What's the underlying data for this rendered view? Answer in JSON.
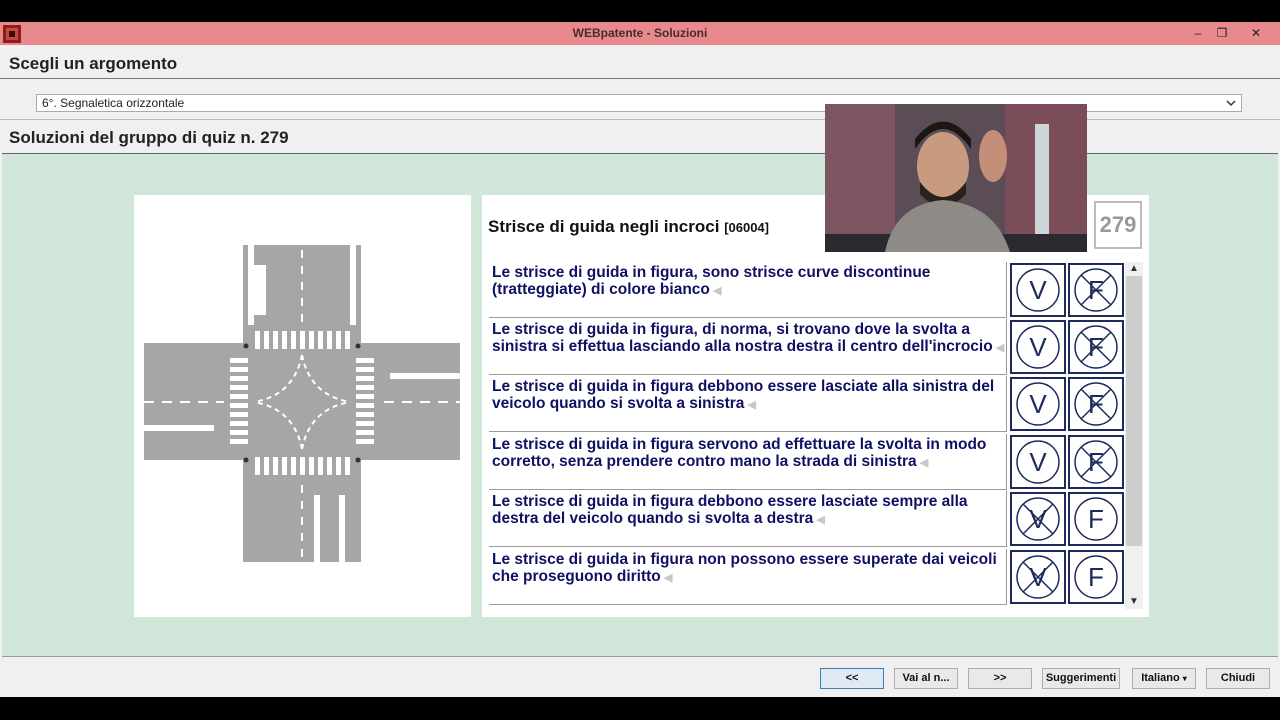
{
  "window": {
    "title": "WEBpatente - Soluzioni",
    "minimize": "–",
    "maximize": "❐",
    "close": "✕"
  },
  "topic": {
    "label": "Scegli un argomento",
    "selected": "6°. Segnaletica orizzontale"
  },
  "group": {
    "label": "Soluzioni del gruppo di quiz n. 279"
  },
  "quiz": {
    "title": "Strisce di guida negli incroci",
    "code": "[06004]",
    "number": "279",
    "questions": [
      {
        "text": "Le strisce di guida in figura, sono strisce curve discontinue (tratteggiate) di colore bianco",
        "answer": "V"
      },
      {
        "text": "Le strisce di guida in figura, di norma, si trovano dove la svolta a sinistra si effettua lasciando alla nostra destra il centro dell'incrocio",
        "answer": "V"
      },
      {
        "text": "Le strisce di guida in figura debbono essere lasciate alla sinistra del veicolo quando si svolta a sinistra",
        "answer": "V"
      },
      {
        "text": "Le strisce di guida in figura servono ad effettuare la svolta in modo corretto, senza prendere contro mano la strada di sinistra",
        "answer": "V"
      },
      {
        "text": "Le strisce di guida in figura debbono essere lasciate sempre alla destra del veicolo quando si svolta a destra",
        "answer": "F"
      },
      {
        "text": "Le strisce di guida in figura non possono essere superate dai veicoli che proseguono diritto",
        "answer": "F"
      }
    ]
  },
  "buttons": {
    "prev": "<<",
    "goto": "Vai al n...",
    "next": ">>",
    "hints": "Suggerimenti",
    "language": "Italiano",
    "close": "Chiudi"
  },
  "colors": {
    "titlebar": "#e8898e",
    "quiz_area": "#cfe6d8",
    "question_text": "#101064",
    "answer_border": "#1d2a5c"
  }
}
